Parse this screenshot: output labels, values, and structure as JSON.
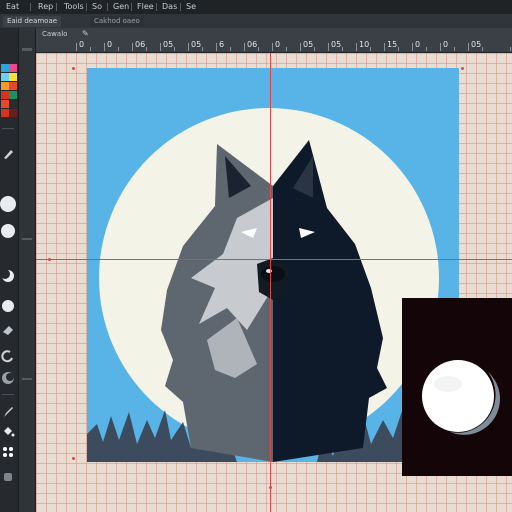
{
  "menubar": {
    "items": [
      "Eat",
      "Rep",
      "Tools",
      "So",
      "Gen",
      "Flee",
      "Das",
      "Se"
    ]
  },
  "tabs": [
    {
      "label": "Eaid deamoae"
    },
    {
      "label": "Cakhod oaeo"
    }
  ],
  "ruler": {
    "crumb": "Cawalo",
    "crumb_icon": "brush-icon",
    "labels": [
      "0",
      "0",
      "06",
      "05",
      "05",
      "6",
      "06",
      "0",
      "05",
      "05",
      "10",
      "15",
      "0",
      "0",
      "05"
    ]
  },
  "colors": {
    "app_bg": "#2b2f33",
    "workspace": "#e7ddd2",
    "grid": "#de8c82",
    "guide": "#d84b4b",
    "artboard_sky": "#58b4e6",
    "moon": "#f4f3e8",
    "wolf_dark": "#0e1a2a",
    "wolf_mid": "#5e6670",
    "wolf_light": "#c7cbd0",
    "preview_bg": "#140508",
    "swatches": [
      "#2aa6d9",
      "#e94a8a",
      "#6dd1f2",
      "#f6e03a",
      "#f29a2b",
      "#e6482e",
      "#d5341f",
      "#1f8f5c",
      "#2c2c2c"
    ]
  },
  "artwork": {
    "subject": "wolf-head-illustration",
    "preview_icon": "moon-orb-icon"
  },
  "tool_icons": [
    "swatch-palette",
    "ellipse-tool-icon",
    "ellipse-tool-icon",
    "moon-tool-icon",
    "moon-tool-icon",
    "eraser-icon",
    "moon-tool-icon",
    "lasso-icon",
    "brush-icon",
    "paint-bucket-icon",
    "eyedropper-icon"
  ]
}
